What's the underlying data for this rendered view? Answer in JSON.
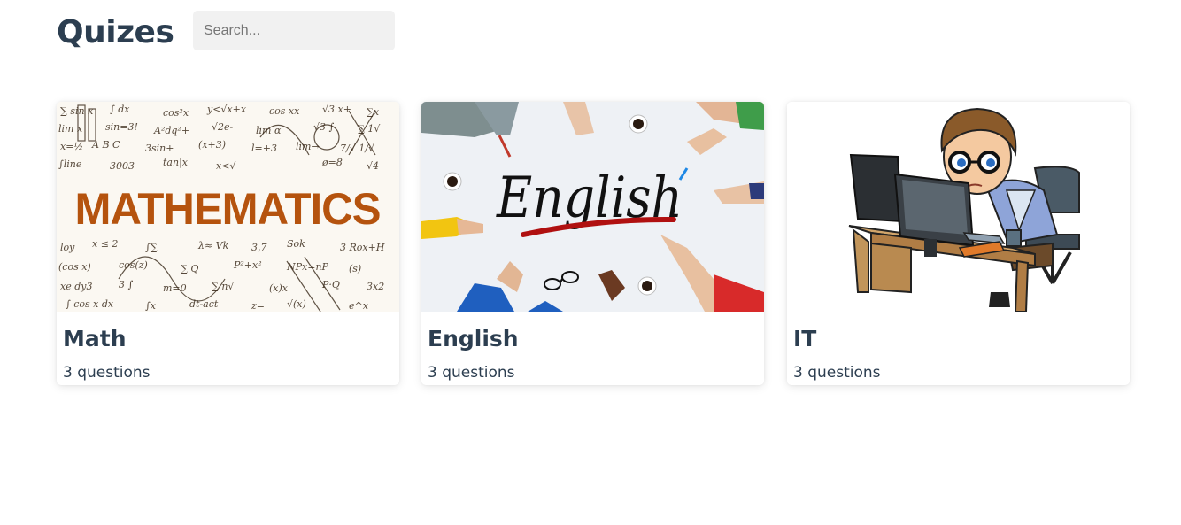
{
  "header": {
    "title": "Quizes",
    "search": {
      "placeholder": "Search...",
      "value": ""
    }
  },
  "quizzes": [
    {
      "title": "Math",
      "subtitle": "3 questions",
      "image_text": "MATHEMATICS",
      "image_icon": "mathematics-image"
    },
    {
      "title": "English",
      "subtitle": "3 questions",
      "image_text": "English",
      "image_icon": "english-image"
    },
    {
      "title": "IT",
      "subtitle": "3 questions",
      "image_icon": "it-programmer-image"
    }
  ],
  "colors": {
    "text": "#2c3e50",
    "search_bg": "#f1f1f1",
    "math_orange": "#b5530e",
    "english_red": "#b01010"
  }
}
